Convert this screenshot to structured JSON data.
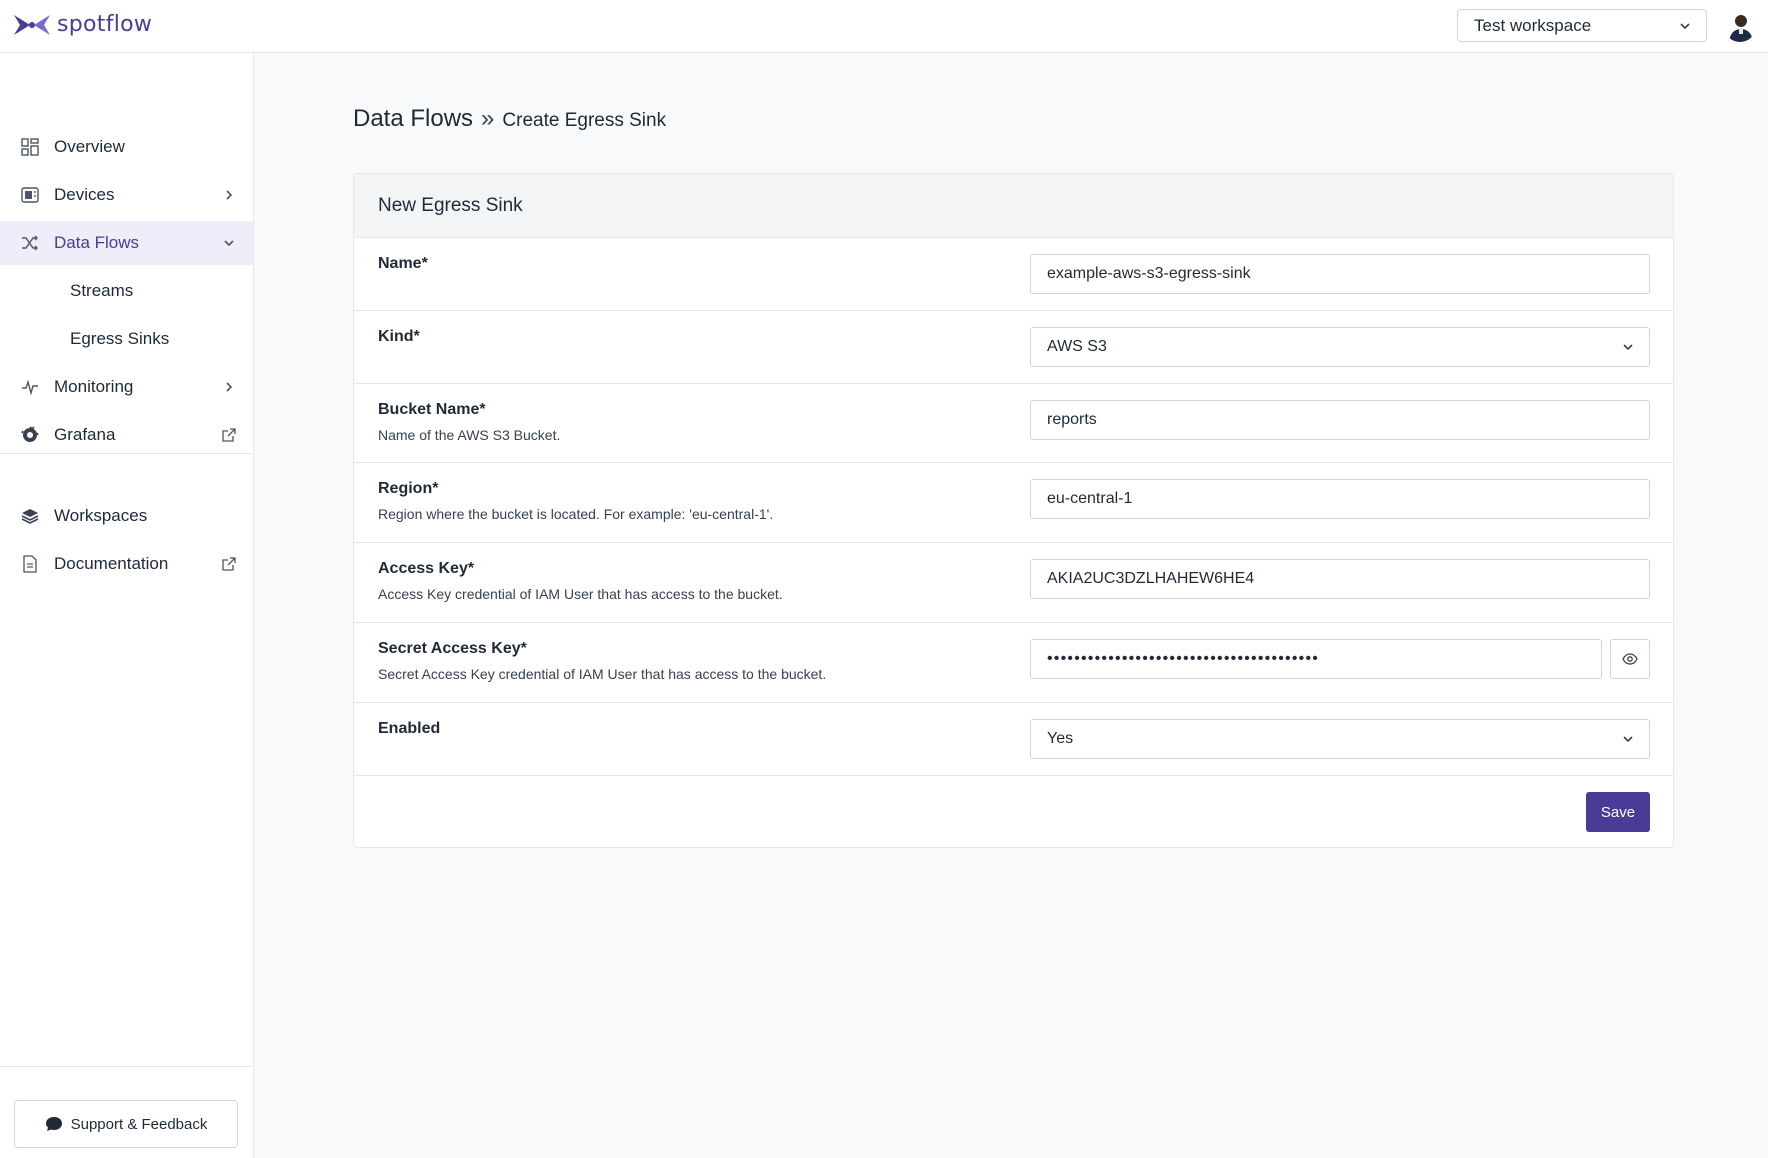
{
  "header": {
    "logo_text": "spotflow",
    "workspace": "Test workspace",
    "brand_color": "#4c3b96"
  },
  "sidebar": {
    "items": [
      {
        "label": "Overview",
        "icon": "grid-icon"
      },
      {
        "label": "Devices",
        "icon": "device-icon"
      },
      {
        "label": "Data Flows",
        "icon": "shuffle-icon"
      },
      {
        "label": "Streams"
      },
      {
        "label": "Egress Sinks"
      },
      {
        "label": "Monitoring",
        "icon": "pulse-icon"
      },
      {
        "label": "Grafana",
        "icon": "grafana-icon"
      },
      {
        "label": "Workspaces",
        "icon": "layers-icon"
      },
      {
        "label": "Documentation",
        "icon": "document-icon"
      }
    ],
    "support_label": "Support & Feedback"
  },
  "breadcrumb": {
    "main": "Data Flows",
    "separator": "»",
    "sub": "Create Egress Sink"
  },
  "form": {
    "title": "New Egress Sink",
    "fields": [
      {
        "label": "Name*",
        "help": "",
        "value": "example-aws-s3-egress-sink"
      },
      {
        "label": "Kind*",
        "help": "",
        "value": "AWS S3"
      },
      {
        "label": "Bucket Name*",
        "help": "Name of the AWS S3 Bucket.",
        "value": "reports"
      },
      {
        "label": "Region*",
        "help": "Region where the bucket is located. For example: 'eu-central-1'.",
        "value": "eu-central-1"
      },
      {
        "label": "Access Key*",
        "help": "Access Key credential of IAM User that has access to the bucket.",
        "value": "AKIA2UC3DZLHAHEW6HE4"
      },
      {
        "label": "Secret Access Key*",
        "help": "Secret Access Key credential of IAM User that has access to the bucket.",
        "value": "••••••••••••••••••••••••••••••••••••••••"
      },
      {
        "label": "Enabled",
        "help": "",
        "value": "Yes"
      }
    ],
    "save_label": "Save"
  }
}
